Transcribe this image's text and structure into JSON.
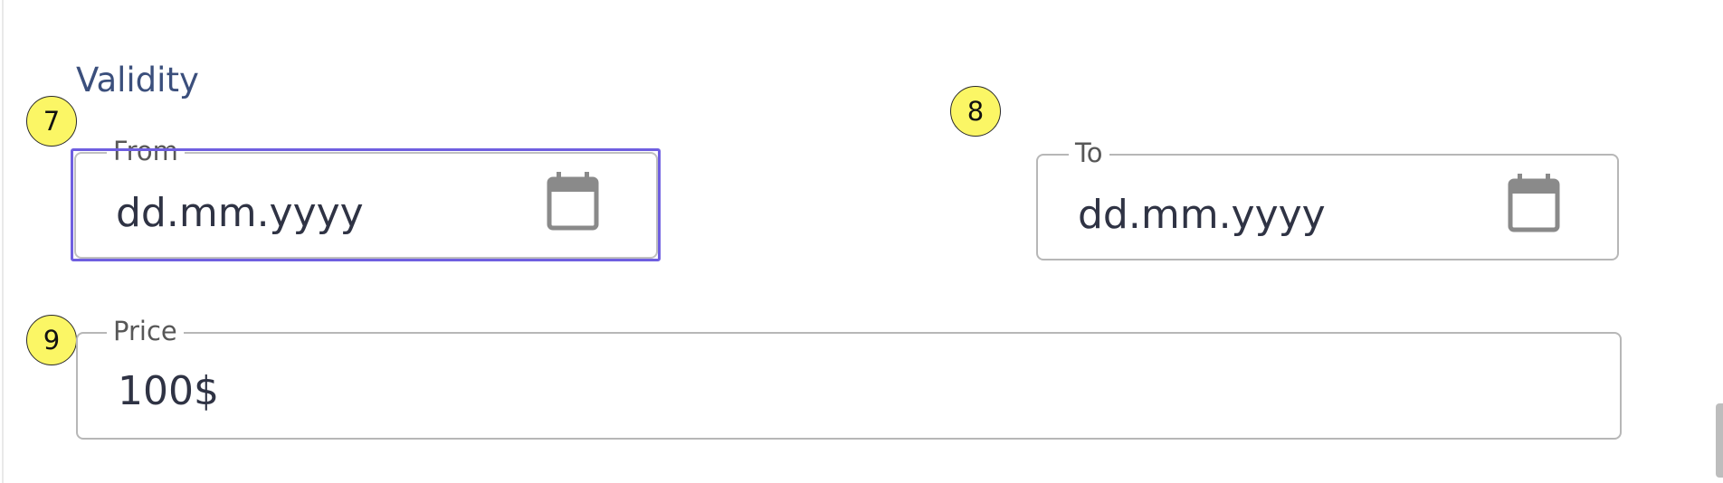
{
  "section": {
    "title": "Validity"
  },
  "annotations": {
    "from_marker": "7",
    "to_marker": "8",
    "price_marker": "9"
  },
  "fields": {
    "from": {
      "label": "From",
      "value": "dd.mm.yyyy",
      "icon": "calendar-icon"
    },
    "to": {
      "label": "To",
      "value": "dd.mm.yyyy",
      "icon": "calendar-icon"
    },
    "price": {
      "label": "Price",
      "value": "100$"
    }
  },
  "colors": {
    "section_title": "#3b4f7c",
    "focus_outline": "#6f5fe0",
    "field_border": "#b7b7b7",
    "marker_fill": "#fbf665",
    "value_text": "#2f3344",
    "icon": "#8a8a8a"
  }
}
